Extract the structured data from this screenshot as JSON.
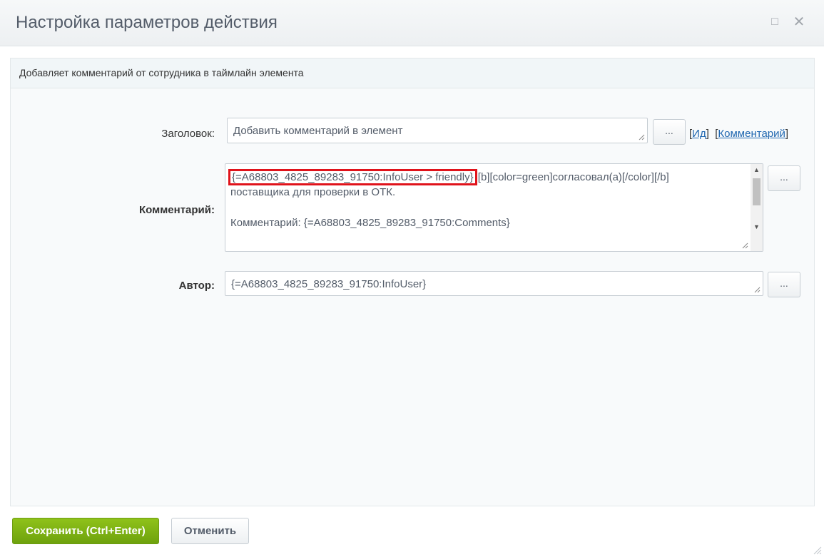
{
  "dialog": {
    "title": "Настройка параметров действия",
    "maximize_glyph": "□",
    "close_glyph": "✕"
  },
  "description": "Добавляет комментарий от сотрудника в таймлайн элемента",
  "fields": {
    "title": {
      "label": "Заголовок:",
      "value": "Добавить комментарий в элемент",
      "button": "...",
      "link_id": "Ид",
      "link_comment": "Комментарий"
    },
    "comment": {
      "label": "Комментарий:",
      "highlighted": "{=A68803_4825_89283_91750:InfoUser > friendly}",
      "line1_rest": "[b][color=green]согласовал(а)[/color][/b]",
      "line2": "поставщика для проверки в ОТК.",
      "line3": "Комментарий: {=A68803_4825_89283_91750:Comments}",
      "button": "..."
    },
    "author": {
      "label": "Автор:",
      "value": "{=A68803_4825_89283_91750:InfoUser}",
      "button": "..."
    }
  },
  "buttons": {
    "save": "Сохранить (Ctrl+Enter)",
    "cancel": "Отменить"
  },
  "colors": {
    "save_green": "#7ab317",
    "highlight_red": "#e0131b",
    "link_blue": "#2067b0"
  }
}
